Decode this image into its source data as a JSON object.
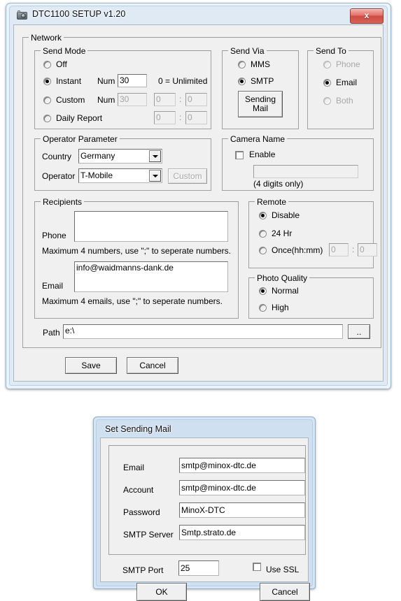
{
  "main_window": {
    "title": "DTC1100 SETUP v1.20",
    "icon": "camera-icon",
    "close_label": "x",
    "network_group": "Network",
    "send_mode": {
      "legend": "Send Mode",
      "off_label": "Off",
      "instant_label": "Instant",
      "custom_label": "Custom",
      "daily_label": "Daily Report",
      "num_label_instant": "Num",
      "num_label_custom": "Num",
      "instant_num_value": "30",
      "custom_num_value": "30",
      "unlimited_hint": "0 = Unlimited",
      "custom_hour": "0",
      "custom_min": "0",
      "daily_hour": "0",
      "daily_min": "0",
      "colon": ":",
      "selected": "Instant"
    },
    "send_via": {
      "legend": "Send Via",
      "mms_label": "MMS",
      "smtp_label": "SMTP",
      "sending_mail_line1": "Sending",
      "sending_mail_line2": "Mail",
      "selected": "SMTP"
    },
    "send_to": {
      "legend": "Send To",
      "phone_label": "Phone",
      "email_label": "Email",
      "both_label": "Both",
      "selected": "Email"
    },
    "operator_parameter": {
      "legend": "Operator Parameter",
      "country_label": "Country",
      "country_value": "Germany",
      "operator_label": "Operator",
      "operator_value": "T-Mobile",
      "custom_button": "Custom"
    },
    "camera_name": {
      "legend": "Camera Name",
      "enable_label": "Enable",
      "name_value": "",
      "hint": "(4 digits only)",
      "enabled": false
    },
    "recipients": {
      "legend": "Recipients",
      "phone_label": "Phone",
      "phone_value": "",
      "phone_hint": "Maximum 4 numbers, use \";\" to seperate numbers.",
      "email_label": "Email",
      "email_value": "info@waidmanns-dank.de",
      "email_hint": "Maximum 4 emails, use \";\" to seperate numbers."
    },
    "remote": {
      "legend": "Remote",
      "disable_label": "Disable",
      "hr24_label": "24 Hr",
      "once_label": "Once(hh:mm)",
      "once_hour": "0",
      "once_min": "0",
      "colon": ":",
      "selected": "Disable"
    },
    "photo_quality": {
      "legend": "Photo Quality",
      "normal_label": "Normal",
      "high_label": "High",
      "selected": "Normal"
    },
    "path": {
      "label": "Path",
      "value": "e:\\",
      "browse_label": ".."
    },
    "save_label": "Save",
    "cancel_label": "Cancel"
  },
  "sending_mail_dialog": {
    "title": "Set Sending Mail",
    "email_label": "Email",
    "email_value": "smtp@minox-dtc.de",
    "account_label": "Account",
    "account_value": "smtp@minox-dtc.de",
    "password_label": "Password",
    "password_value": "MinoX-DTC",
    "smtp_server_label": "SMTP Server",
    "smtp_server_value": "Smtp.strato.de",
    "smtp_port_label": "SMTP Port",
    "smtp_port_value": "25",
    "use_ssl_label": "Use SSL",
    "use_ssl_checked": false,
    "ok_label": "OK",
    "cancel_label": "Cancel"
  },
  "colors": {
    "window_frame": "#eaf2fa",
    "client_bg": "#f0f0f0",
    "close_red": "#cf4c42",
    "disabled_text": "#a8a8a8"
  }
}
